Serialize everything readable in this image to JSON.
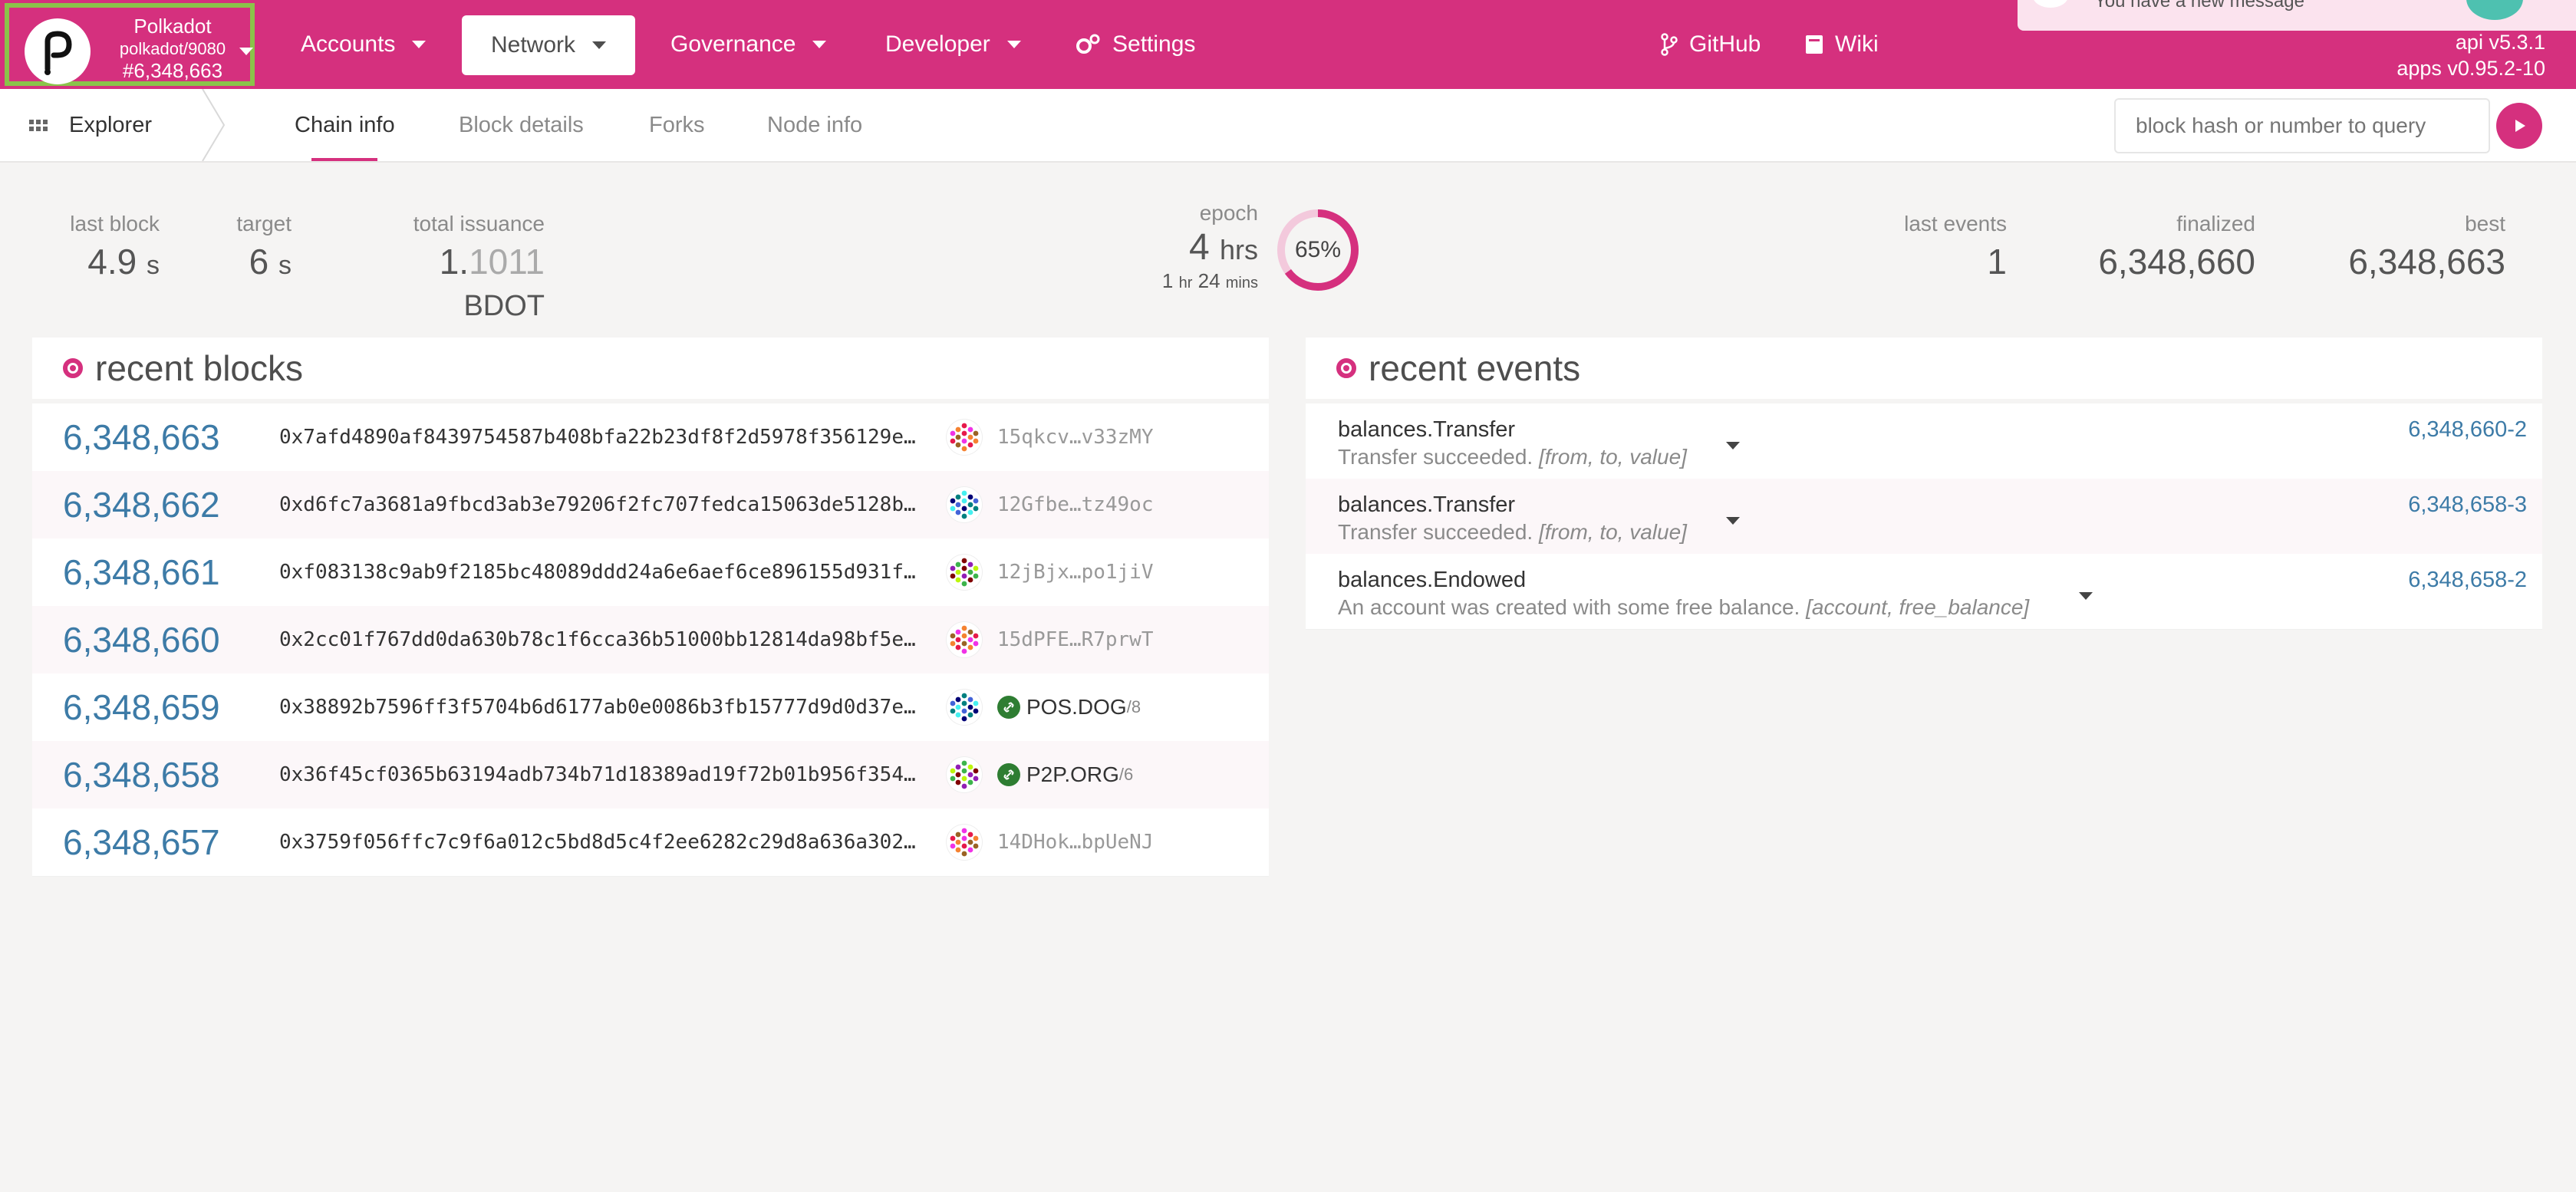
{
  "header": {
    "chain_name": "Polkadot",
    "chain_sub": "polkadot/9080",
    "chain_block": "#6,348,663",
    "nav": [
      {
        "label": "Accounts"
      },
      {
        "label": "Network"
      },
      {
        "label": "Governance"
      },
      {
        "label": "Developer"
      },
      {
        "label": "Settings"
      },
      {
        "label": "GitHub"
      },
      {
        "label": "Wiki"
      }
    ],
    "toast": "You have a new message",
    "api_version": "api v5.3.1",
    "apps_version": "apps v0.95.2-10"
  },
  "subnav": {
    "section": "Explorer",
    "tabs": [
      "Chain info",
      "Block details",
      "Forks",
      "Node info"
    ],
    "query_placeholder": "block hash or number to query"
  },
  "summary": {
    "last_block": {
      "label": "last block",
      "value": "4.9",
      "unit": "s"
    },
    "target": {
      "label": "target",
      "value": "6",
      "unit": "s"
    },
    "total_issuance": {
      "label": "total issuance",
      "int": "1.",
      "dec": "1011",
      "unit": "BDOT"
    },
    "epoch": {
      "label": "epoch",
      "value": "4",
      "unit": "hrs",
      "sub_hr": "1",
      "sub_hr_unit": "hr",
      "sub_min": "24",
      "sub_min_unit": "mins",
      "percent": "65%",
      "progress": 0.65
    },
    "last_events": {
      "label": "last events",
      "value": "1"
    },
    "finalized": {
      "label": "finalized",
      "value": "6,348,660"
    },
    "best": {
      "label": "best",
      "value": "6,348,663"
    }
  },
  "recent_blocks": {
    "title": "recent blocks",
    "rows": [
      {
        "number": "6,348,663",
        "hash": "0x7afd4890af8439754587b408bfa22b23df8f2d5978f356129e…",
        "author": "15qkcv…v33zMY"
      },
      {
        "number": "6,348,662",
        "hash": "0xd6fc7a3681a9fbcd3ab3e79206f2fc707fedca15063de5128b…",
        "author": "12Gfbe…tz49oc"
      },
      {
        "number": "6,348,661",
        "hash": "0xf083138c9ab9f2185bc48089ddd24a6e6aef6ce896155d931f…",
        "author": "12jBjx…po1jiV"
      },
      {
        "number": "6,348,660",
        "hash": "0x2cc01f767dd0da630b78c1f6cca36b51000bb12814da98bf5e…",
        "author": "15dPFE…R7prwT"
      },
      {
        "number": "6,348,659",
        "hash": "0x38892b7596ff3f5704b6d6177ab0e0086b3fb15777d9d0d37e…",
        "author": "POS.DOG",
        "author_sub": "/8"
      },
      {
        "number": "6,348,658",
        "hash": "0x36f45cf0365b63194adb734b71d18389ad19f72b01b956f354…",
        "author": "P2P.ORG",
        "author_sub": "/6"
      },
      {
        "number": "6,348,657",
        "hash": "0x3759f056ffc7c9f6a012c5bd8d5c4f2ee6282c29d8a636a302…",
        "author": "14DHok…bpUeNJ"
      }
    ]
  },
  "recent_events": {
    "title": "recent events",
    "rows": [
      {
        "method": "balances.Transfer",
        "desc": "Transfer succeeded.",
        "args": "[from, to, value]",
        "link": "6,348,660-2"
      },
      {
        "method": "balances.Transfer",
        "desc": "Transfer succeeded.",
        "args": "[from, to, value]",
        "link": "6,348,658-3"
      },
      {
        "method": "balances.Endowed",
        "desc": "An account was created with some free balance.",
        "args": "[account, free_balance]",
        "link": "6,348,658-2"
      }
    ]
  },
  "colors": {
    "brand": "#d5307e",
    "link": "#3d7ba7",
    "highlight": "#8bc34a"
  }
}
